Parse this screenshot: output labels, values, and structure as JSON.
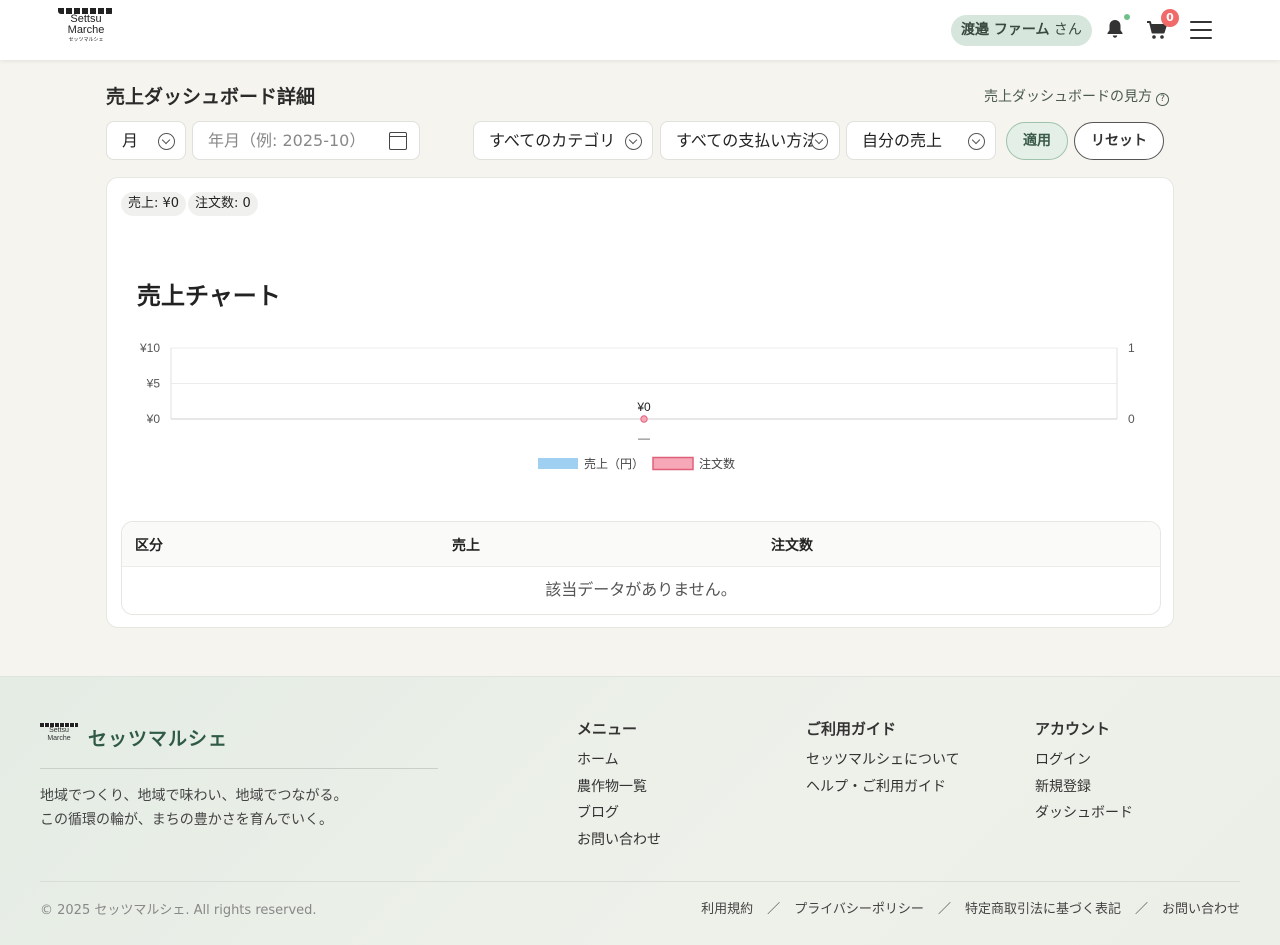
{
  "header": {
    "logo_line1": "Settsu",
    "logo_line2": "Marche",
    "logo_sub": "セッツマルシェ",
    "user_name": "渡邉 ファーム",
    "user_suffix": "さん",
    "cart_count": "0"
  },
  "page": {
    "title": "売上ダッシュボード詳細",
    "help_link": "売上ダッシュボードの見方"
  },
  "filters": {
    "period": "月",
    "month_placeholder": "年月（例: 2025-10）",
    "category": "すべてのカテゴリ",
    "payment": "すべての支払い方法",
    "scope": "自分の売上",
    "apply": "適用",
    "reset": "リセット"
  },
  "summary": {
    "sales": "売上: ¥0",
    "orders": "注文数: 0"
  },
  "chart_data": {
    "type": "bar",
    "title": "売上チャート",
    "categories": [
      "—"
    ],
    "series": [
      {
        "name": "売上（円）",
        "values": [
          0
        ],
        "color": "#9fd0f2",
        "axis": "left"
      },
      {
        "name": "注文数",
        "values": [
          0
        ],
        "color": "#f7a8b8",
        "axis": "right"
      }
    ],
    "y_left": {
      "ticks": [
        "¥0",
        "¥5",
        "¥10"
      ],
      "range": [
        0,
        10
      ]
    },
    "y_right": {
      "ticks": [
        "0",
        "1"
      ],
      "range": [
        0,
        1
      ]
    },
    "data_labels": [
      "¥0"
    ],
    "legend": "bottom"
  },
  "table": {
    "headers": [
      "区分",
      "売上",
      "注文数"
    ],
    "empty": "該当データがありません。"
  },
  "footer": {
    "brand": "セッツマルシェ",
    "tagline1": "地域でつくり、地域で味わい、地域でつながる。",
    "tagline2": "この循環の輪が、まちの豊かさを育んでいく。",
    "menu": {
      "title": "メニュー",
      "items": [
        "ホーム",
        "農作物一覧",
        "ブログ",
        "お問い合わせ"
      ]
    },
    "guide": {
      "title": "ご利用ガイド",
      "items": [
        "セッツマルシェについて",
        "ヘルプ・ご利用ガイド"
      ]
    },
    "account": {
      "title": "アカウント",
      "items": [
        "ログイン",
        "新規登録",
        "ダッシュボード"
      ]
    },
    "copyright": "© 2025 セッツマルシェ. All rights reserved.",
    "links": [
      "利用規約",
      "プライバシーポリシー",
      "特定商取引法に基づく表記",
      "お問い合わせ"
    ],
    "sep": "／"
  }
}
